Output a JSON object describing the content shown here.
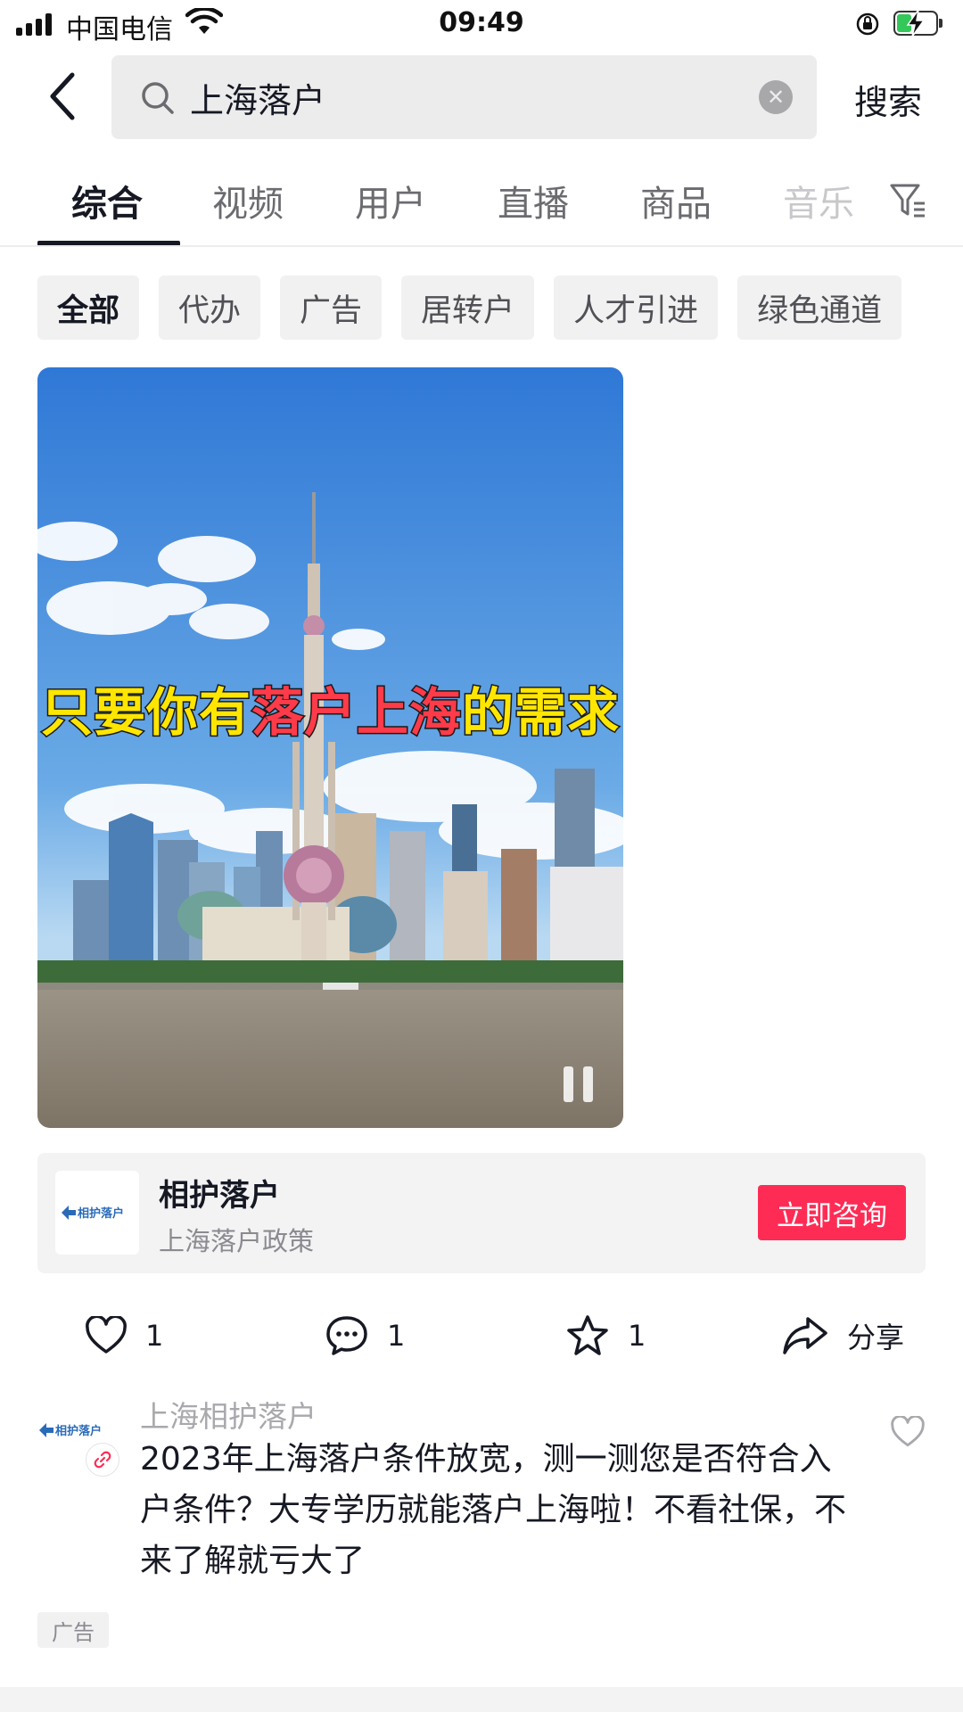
{
  "status_bar": {
    "carrier": "中国电信",
    "time": "09:49"
  },
  "search": {
    "query": "上海落户",
    "button_label": "搜索"
  },
  "tabs": [
    {
      "label": "综合",
      "active": true
    },
    {
      "label": "视频"
    },
    {
      "label": "用户"
    },
    {
      "label": "直播"
    },
    {
      "label": "商品"
    },
    {
      "label": "音乐"
    }
  ],
  "chips": [
    "全部",
    "代办",
    "广告",
    "居转户",
    "人才引进",
    "绿色通道"
  ],
  "video": {
    "caption_parts": [
      "只要你有",
      "落户上海",
      "的需求"
    ]
  },
  "ad_card": {
    "name": "相护落户",
    "subtitle": "上海落户政策",
    "cta_label": "立即咨询",
    "logo_text": "相护落户"
  },
  "actions": {
    "like_count": "1",
    "comment_count": "1",
    "favorite_count": "1",
    "share_label": "分享"
  },
  "post": {
    "author": "上海相护落户",
    "text": "2023年上海落户条件放宽，测一测您是否符合入户条件？大专学历就能落户上海啦！不看社保，不来了解就亏大了",
    "ad_tag": "广告",
    "logo_text": "相护落户"
  },
  "colors": {
    "accent": "#fe2c55",
    "caption_yellow": "#ffe600",
    "caption_red": "#ff3b4a"
  }
}
